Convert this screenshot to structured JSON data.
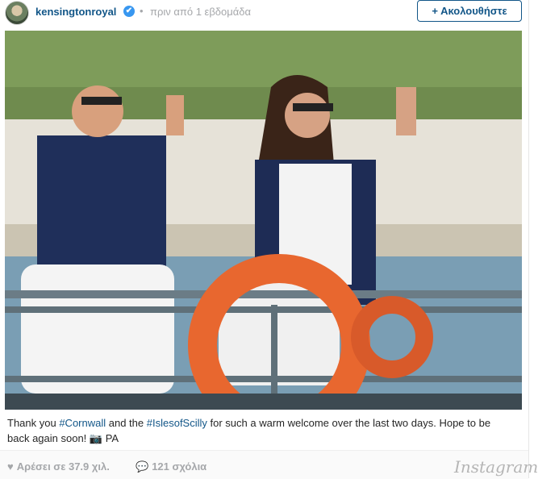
{
  "header": {
    "username": "kensingtonroyal",
    "verified_icon": "✔",
    "separator": "•",
    "timestamp": "πριν από 1 εβδομάδα",
    "follow_label": "+ Ακολουθήστε"
  },
  "photo": {
    "description_icon": "photo"
  },
  "caption": {
    "part1": "Thank you ",
    "tag1": "#Cornwall",
    "part2": " and the ",
    "tag2": "#IslesofScilly",
    "part3": " for such a warm welcome over the last two days. Hope to be back again soon! ",
    "camera": "📷",
    "credit": " PA"
  },
  "footer": {
    "heart_icon": "♥",
    "likes": "Αρέσει σε 37.9 χιλ.",
    "comment_icon": "💬",
    "comments": "121 σχόλια",
    "logo": "Instagram"
  },
  "colors": {
    "link": "#125688",
    "muted": "#a5a7aa",
    "verified": "#3897f0"
  }
}
